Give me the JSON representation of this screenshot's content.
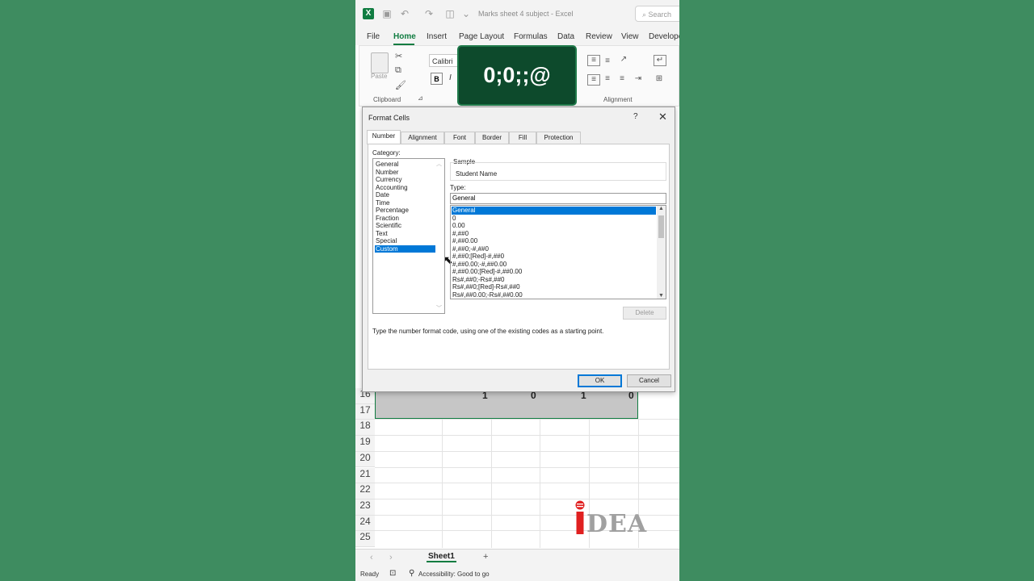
{
  "app": {
    "doc_title": "Marks sheet 4 subject  -  Excel",
    "search_placeholder": "Search"
  },
  "ribbon_tabs": [
    "File",
    "Home",
    "Insert",
    "Page Layout",
    "Formulas",
    "Data",
    "Review",
    "View",
    "Develope"
  ],
  "ribbon": {
    "paste_label": "Paste",
    "clipboard_label": "Clipboard",
    "font_name": "Calibri",
    "bold_label": "B",
    "italic_label": "I",
    "alignment_label": "Alignment"
  },
  "overlay_text": "0;0;;@",
  "sheet": {
    "rows": [
      "16",
      "17",
      "18",
      "19",
      "20",
      "21",
      "22",
      "23",
      "24",
      "25"
    ],
    "row16_values": [
      "1",
      "0",
      "1",
      "0"
    ],
    "sheet_tab": "Sheet1",
    "add_sheet": "+"
  },
  "status": {
    "ready": "Ready",
    "accessibility": "Accessibility: Good to go"
  },
  "logo": {
    "text": "DEA"
  },
  "dialog": {
    "title": "Format Cells",
    "help": "?",
    "close": "✕",
    "tabs": [
      "Number",
      "Alignment",
      "Font",
      "Border",
      "Fill",
      "Protection"
    ],
    "category_label": "Category:",
    "categories": [
      "General",
      "Number",
      "Currency",
      "Accounting",
      "Date",
      "Time",
      "Percentage",
      "Fraction",
      "Scientific",
      "Text",
      "Special",
      "Custom"
    ],
    "selected_category": "Custom",
    "sample_label": "Sample",
    "sample_value": "Student Name",
    "type_label": "Type:",
    "type_value": "General",
    "type_list": [
      "General",
      "0",
      "0.00",
      "#,##0",
      "#,##0.00",
      "#,##0;-#,##0",
      "#,##0;[Red]-#,##0",
      "#,##0.00;-#,##0.00",
      "#,##0.00;[Red]-#,##0.00",
      "Rs#,##0;-Rs#,##0",
      "Rs#,##0;[Red]-Rs#,##0",
      "Rs#,##0.00;-Rs#,##0.00"
    ],
    "delete_label": "Delete",
    "hint": "Type the number format code, using one of the existing codes as a starting point.",
    "ok_label": "OK",
    "cancel_label": "Cancel"
  }
}
